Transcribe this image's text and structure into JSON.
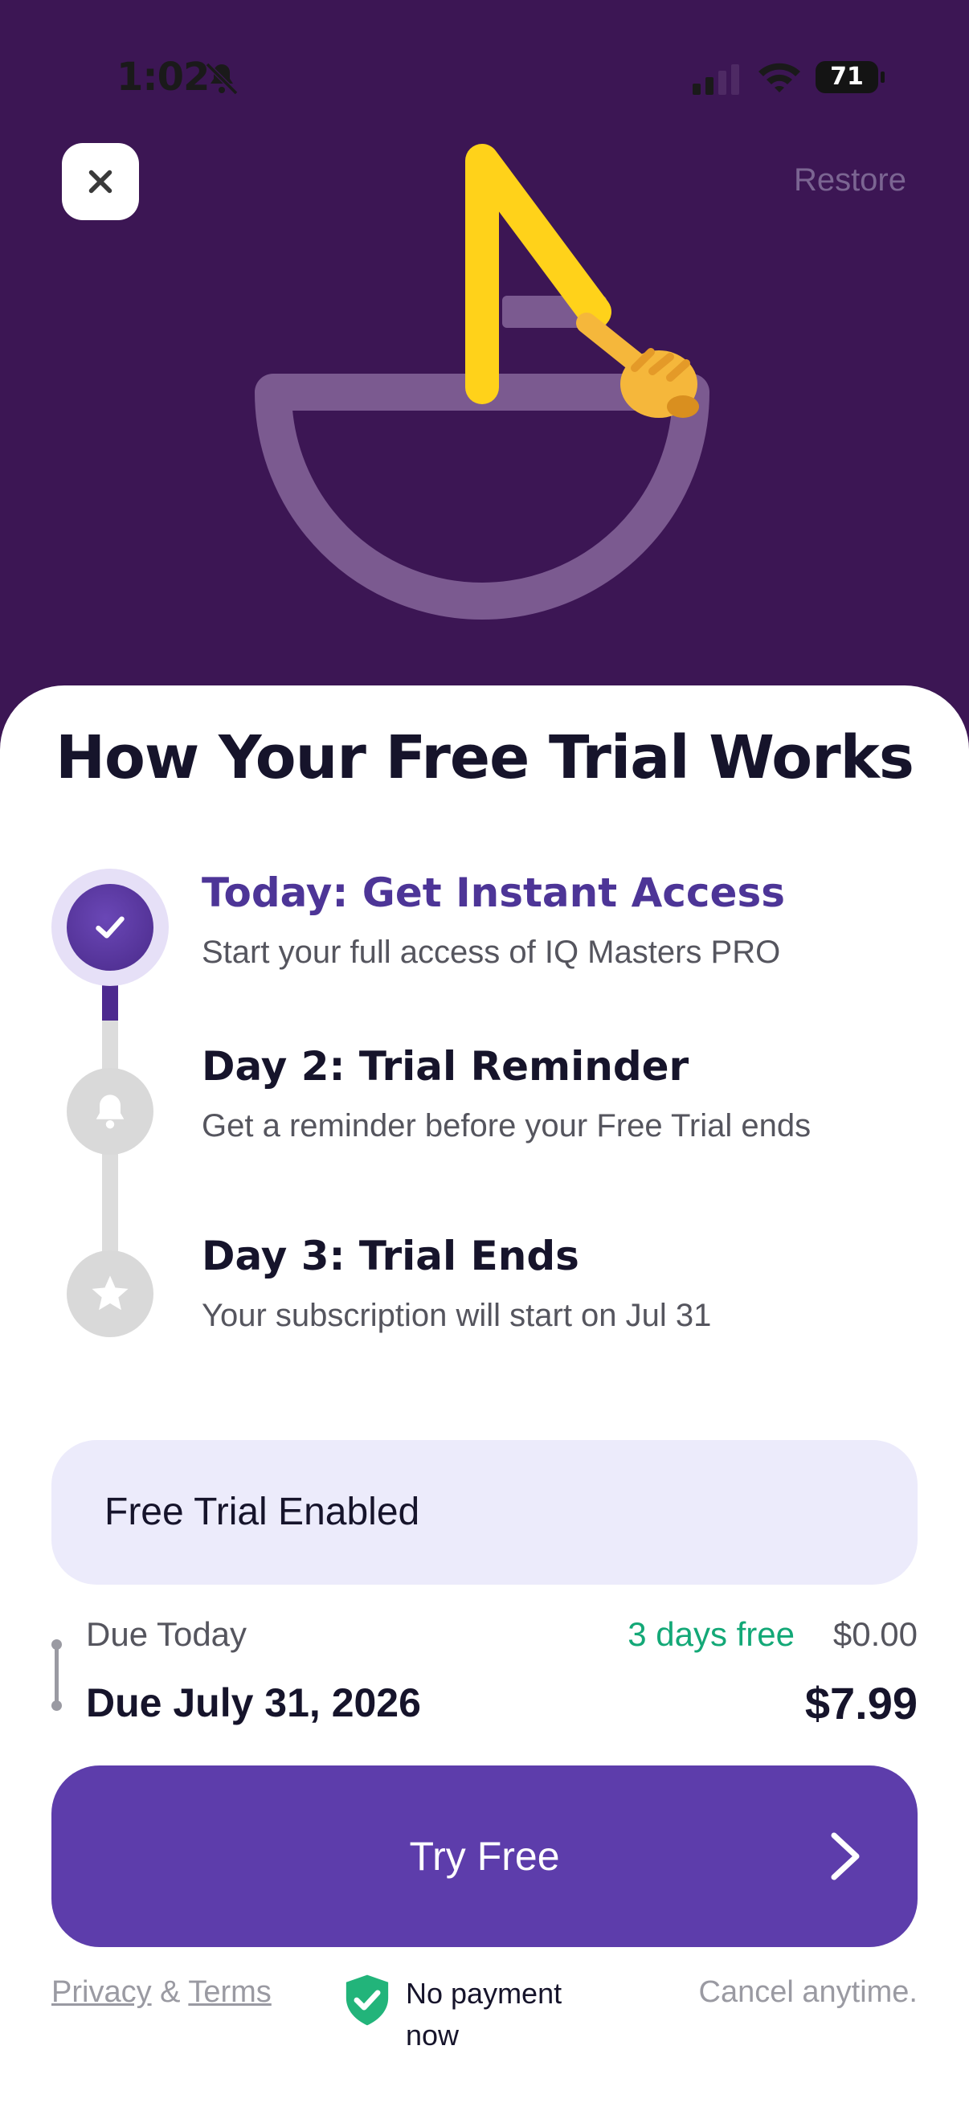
{
  "status_bar": {
    "time": "1:02",
    "battery": "71"
  },
  "header": {
    "restore_label": "Restore"
  },
  "colors": {
    "background": "#3c1654",
    "accent": "#5d3dab",
    "active_step": "#4d3597",
    "free_green": "#13a877",
    "highlight_box": "#ecebfb"
  },
  "title": "How Your Free Trial Works",
  "steps": [
    {
      "title": "Today: Get Instant Access",
      "description": "Start your full access of IQ Masters PRO",
      "icon": "check-icon"
    },
    {
      "title": "Day 2: Trial Reminder",
      "description": "Get a reminder before your Free Trial ends",
      "icon": "bell-icon"
    },
    {
      "title": "Day 3: Trial Ends",
      "description": "Your subscription will start on Jul 31",
      "icon": "star-icon"
    }
  ],
  "trial_toggle": {
    "label": "Free Trial Enabled"
  },
  "billing": {
    "due_today_label": "Due Today",
    "free_days_label": "3 days free",
    "due_today_price": "$0.00",
    "due_later_label": "Due July 31, 2026",
    "due_later_price": "$7.99"
  },
  "cta": {
    "label": "Try Free"
  },
  "footer": {
    "privacy": "Privacy",
    "amp": " & ",
    "terms": "Terms",
    "no_payment": "No payment now",
    "cancel": "Cancel anytime."
  }
}
